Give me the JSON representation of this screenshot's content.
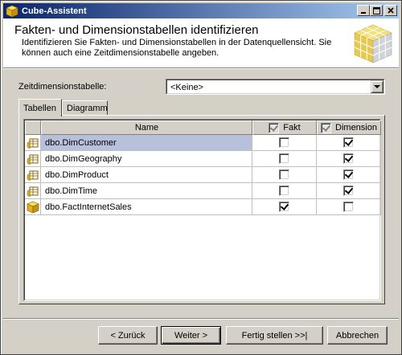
{
  "window": {
    "title": "Cube-Assistent"
  },
  "header": {
    "title": "Fakten- und Dimensionstabellen identifizieren",
    "description": "Identifizieren Sie Fakten- und Dimensionstabellen in der Datenquellensicht. Sie können auch eine Zeitdimensionstabelle angeben."
  },
  "time_dimension": {
    "label": "Zeitdimensionstabelle:",
    "selected": "<Keine>"
  },
  "tabs": [
    {
      "label": "Tabellen",
      "active": true
    },
    {
      "label": "Diagramm",
      "active": false
    }
  ],
  "grid": {
    "columns": {
      "name": "Name",
      "fact": "Fakt",
      "dimension": "Dimension"
    },
    "rows": [
      {
        "name": "dbo.DimCustomer",
        "fact": false,
        "dimension": true,
        "icon": "dimension-table-icon",
        "selected": true
      },
      {
        "name": "dbo.DimGeography",
        "fact": false,
        "dimension": true,
        "icon": "dimension-table-icon"
      },
      {
        "name": "dbo.DimProduct",
        "fact": false,
        "dimension": true,
        "icon": "dimension-table-icon"
      },
      {
        "name": "dbo.DimTime",
        "fact": false,
        "dimension": true,
        "icon": "dimension-table-icon"
      },
      {
        "name": "dbo.FactInternetSales",
        "fact": true,
        "dimension": false,
        "icon": "fact-table-icon"
      }
    ]
  },
  "buttons": {
    "back": "< Zurück",
    "next": "Weiter >",
    "finish": "Fertig stellen >>|",
    "cancel": "Abbrechen"
  },
  "colors": {
    "titlebar_start": "#0a246a",
    "titlebar_end": "#a6caf0",
    "selection": "#b8c1dc",
    "face": "#d4d0c8"
  }
}
